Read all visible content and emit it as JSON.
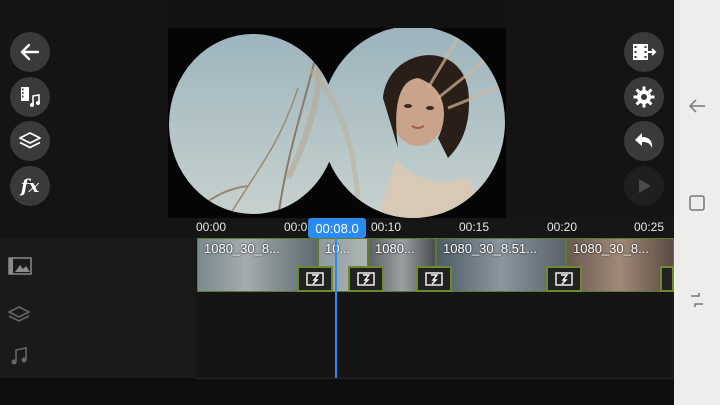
{
  "left_toolbar": {
    "buttons": [
      {
        "icon": "back-arrow-icon"
      },
      {
        "icon": "media-music-icon"
      },
      {
        "icon": "layers-icon"
      },
      {
        "icon": "fx-icon",
        "label": "fx"
      }
    ]
  },
  "right_toolbar": {
    "buttons": [
      {
        "icon": "export-film-icon"
      },
      {
        "icon": "gear-icon"
      },
      {
        "icon": "undo-icon"
      },
      {
        "icon": "play-icon",
        "disabled": true
      }
    ]
  },
  "timeline": {
    "current_time": "00:08.0",
    "ruler_ticks": [
      "00:00",
      "00:05",
      "00:10",
      "00:15",
      "00:20",
      "00:25"
    ],
    "clips": [
      {
        "label": "1080_30_8..."
      },
      {
        "label": "10..."
      },
      {
        "label": "1080..."
      },
      {
        "label": "1080_30_8.51..."
      },
      {
        "label": "1080_30_8..."
      }
    ],
    "tracks": [
      {
        "icon": "image-track-icon"
      },
      {
        "icon": "layers-track-icon"
      },
      {
        "icon": "music-track-icon"
      }
    ]
  },
  "colors": {
    "accent": "#2a8cf0",
    "transition_border": "#6e8a2f",
    "button_bg": "#3a3a3a"
  },
  "nav": {
    "buttons": [
      {
        "icon": "nav-back-icon"
      },
      {
        "icon": "nav-home-icon"
      },
      {
        "icon": "nav-recents-icon"
      }
    ]
  }
}
